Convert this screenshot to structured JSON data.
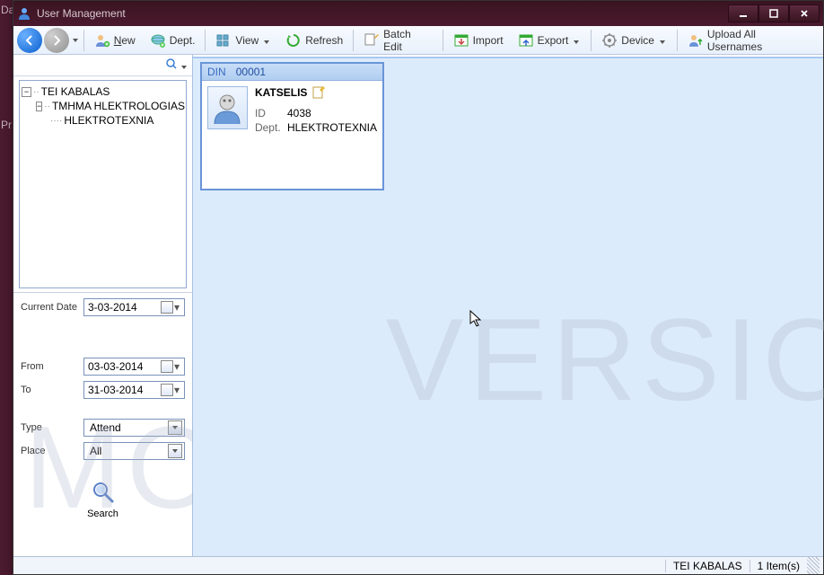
{
  "window": {
    "title": "User Management"
  },
  "toolbar": {
    "new": "New",
    "dept": "Dept.",
    "view": "View",
    "refresh": "Refresh",
    "batch_edit": "Batch Edit",
    "import": "Import",
    "export": "Export",
    "device": "Device",
    "upload": "Upload All Usernames"
  },
  "tree": {
    "root": "TEI KABALAS",
    "child1": "TMHMA HLEKTROLOGIAS",
    "child2": "HLEKTROTEXNIA"
  },
  "filters": {
    "current_date_label": "Current Date",
    "current_date": "3-03-2014",
    "from_label": "From",
    "from": "03-03-2014",
    "to_label": "To",
    "to": "31-03-2014",
    "type_label": "Type",
    "type": "Attend",
    "place_label": "Place",
    "place": "All",
    "search": "Search"
  },
  "card": {
    "din_label": "DIN",
    "din": "00001",
    "name": "KATSELIS",
    "id_label": "ID",
    "id": "4038",
    "dept_label": "Dept.",
    "dept": "HLEKTROTEXNIA"
  },
  "status": {
    "path": "TEI KABALAS",
    "count": "1 Item(s)"
  },
  "watermark_left": "MO",
  "watermark_right": "VERSIO",
  "left_strip": [
    "Da",
    "",
    "Pr"
  ]
}
